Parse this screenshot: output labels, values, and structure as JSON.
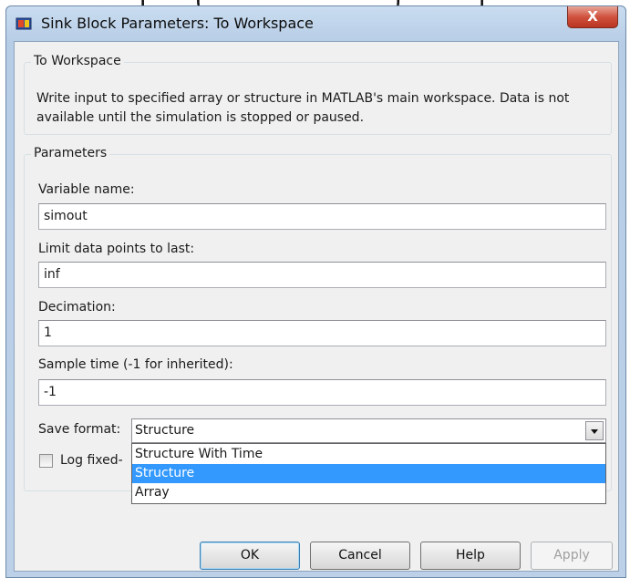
{
  "window": {
    "title": "Sink Block Parameters: To Workspace",
    "close_glyph": "X"
  },
  "block_group": {
    "label": "To Workspace",
    "description": "Write input to specified array or structure in MATLAB's main workspace. Data is not available until the simulation is stopped or paused."
  },
  "params_group": {
    "label": "Parameters",
    "variable_name": {
      "label": "Variable name:",
      "value": "simout"
    },
    "limit_points": {
      "label": "Limit data points to last:",
      "value": "inf"
    },
    "decimation": {
      "label": "Decimation:",
      "value": "1"
    },
    "sample_time": {
      "label": "Sample time (-1 for inherited):",
      "value": "-1"
    },
    "save_format": {
      "label": "Save format:",
      "selected": "Structure",
      "options": [
        "Structure With Time",
        "Structure",
        "Array"
      ]
    },
    "log_fixed": {
      "label_visible": "Log fixed-",
      "checked": false
    }
  },
  "buttons": {
    "ok": "OK",
    "cancel": "Cancel",
    "help": "Help",
    "apply": "Apply"
  },
  "colors": {
    "selection": "#3399ff",
    "close_button": "#c94a35",
    "title_bar": "#c9dcf0"
  }
}
